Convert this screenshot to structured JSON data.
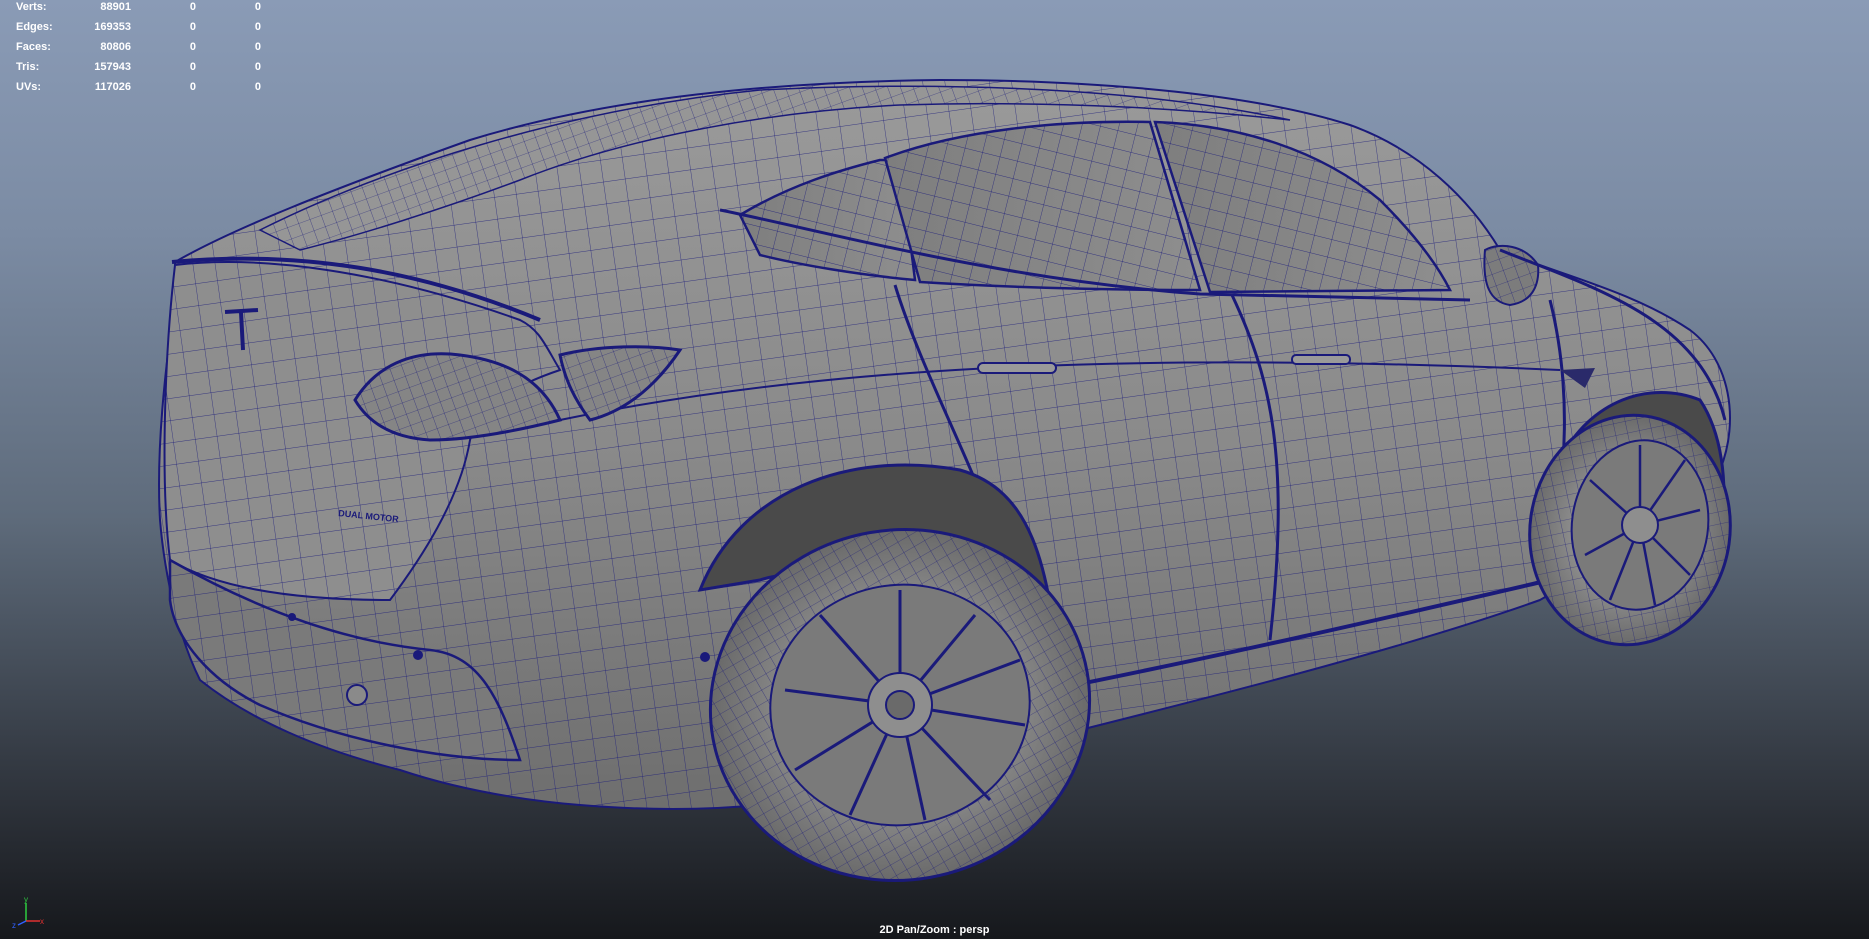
{
  "hud": {
    "rows": [
      {
        "label": "Verts:",
        "v1": "88901",
        "v2": "0",
        "v3": "0"
      },
      {
        "label": "Edges:",
        "v1": "169353",
        "v2": "0",
        "v3": "0"
      },
      {
        "label": "Faces:",
        "v1": "80806",
        "v2": "0",
        "v3": "0"
      },
      {
        "label": "Tris:",
        "v1": "157943",
        "v2": "0",
        "v3": "0"
      },
      {
        "label": "UVs:",
        "v1": "117026",
        "v2": "0",
        "v3": "0"
      }
    ]
  },
  "viewport": {
    "camera_caption": "2D Pan/Zoom : persp",
    "badge_text": "DUAL MOTOR",
    "wire_color": "#1a1a7a",
    "shade_color": "#8c8c8c"
  },
  "gizmo": {
    "x": "x",
    "y": "y",
    "z": "z"
  }
}
